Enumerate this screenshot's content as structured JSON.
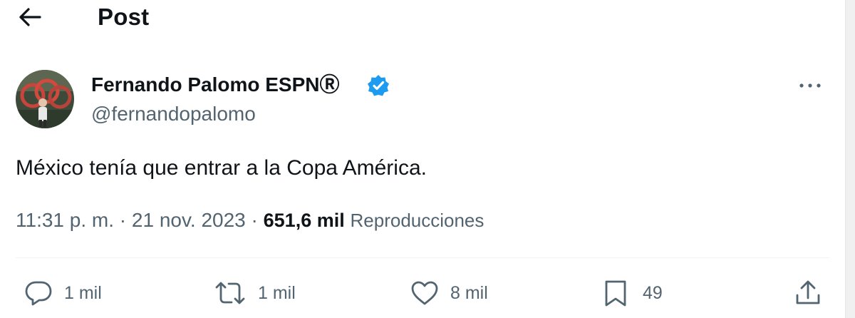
{
  "header": {
    "title": "Post"
  },
  "post": {
    "author_name": "Fernando Palomo ESPNⓇ",
    "handle": "@fernandopalomo",
    "text": "México tenía que entrar a la Copa América.",
    "time": "11:31 p. m.",
    "date": "21 nov. 2023",
    "separator": " · ",
    "views_count": "651,6 mil",
    "views_label": "Reproducciones"
  },
  "actions": {
    "replies": "1 mil",
    "reposts": "1 mil",
    "likes": "8 mil",
    "bookmarks": "49"
  },
  "colors": {
    "text": "#0f1419",
    "secondary": "#536471",
    "verified": "#1d9bf0",
    "divider": "#eff3f4"
  }
}
